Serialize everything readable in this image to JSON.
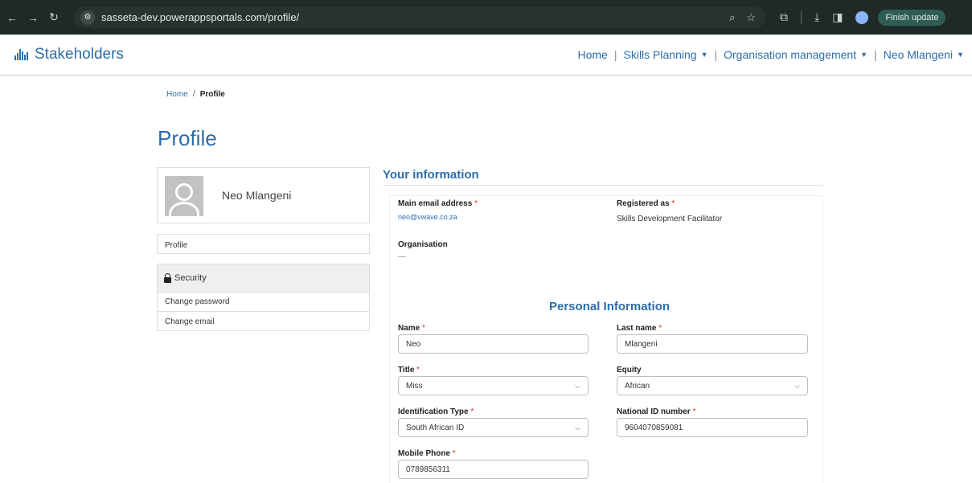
{
  "browser": {
    "url": "sasseta-dev.powerappsportals.com/profile/",
    "finish_update_label": "Finish update"
  },
  "header": {
    "brand": "Stakeholders",
    "nav": [
      {
        "label": "Home"
      },
      {
        "label": "Skills Planning"
      },
      {
        "label": "Organisation management"
      },
      {
        "label": "Neo Mlangeni"
      }
    ]
  },
  "breadcrumb": {
    "home": "Home",
    "separator": "/",
    "current": "Profile"
  },
  "page_title": "Profile",
  "sidebar": {
    "user_name": "Neo Mlangeni",
    "profile_link": "Profile",
    "security_heading": "Security",
    "security_links": [
      "Change password",
      "Change email"
    ]
  },
  "your_information": {
    "title": "Your information",
    "main_email_label": "Main email address",
    "main_email_value": "neo@vwave.co.za",
    "registered_as_label": "Registered as",
    "registered_as_value": "Skills Development Facilitator",
    "organisation_label": "Organisation",
    "organisation_value": "—"
  },
  "personal_information": {
    "title": "Personal Information",
    "name_label": "Name",
    "name_value": "Neo",
    "last_name_label": "Last name",
    "last_name_value": "Mlangeni",
    "title_label": "Title",
    "title_value": "Miss",
    "equity_label": "Equity",
    "equity_value": "African",
    "id_type_label": "Identification Type",
    "id_type_value": "South African ID",
    "national_id_label": "National ID number",
    "national_id_value": "9604070859081",
    "mobile_label": "Mobile Phone",
    "mobile_value": "0789856311"
  },
  "required_marker": "*"
}
